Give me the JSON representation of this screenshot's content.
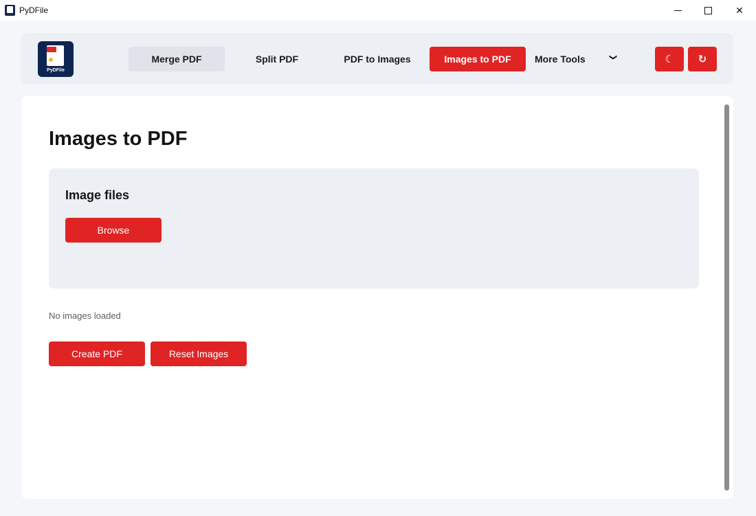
{
  "window": {
    "title": "PyDFile",
    "minimize_glyph": "",
    "maximize_glyph": "",
    "close_glyph": "✕"
  },
  "logo": {
    "badge": "PDF",
    "text": "PyDFile"
  },
  "nav": {
    "merge": "Merge PDF",
    "split": "Split PDF",
    "pdf_to_images": "PDF to Images",
    "images_to_pdf": "Images to PDF",
    "more_tools": "More Tools",
    "more_chevron": "❯",
    "active": "Images to PDF"
  },
  "actions": {
    "theme_icon": "☾",
    "refresh_icon": "↻"
  },
  "main": {
    "title": "Images to PDF",
    "card_title": "Image files",
    "browse_label": "Browse",
    "status": "No images loaded",
    "create_label": "Create PDF",
    "reset_label": "Reset Images"
  },
  "colors": {
    "accent": "#e02424",
    "panel": "#eceff4",
    "background": "#f5f6fa",
    "logo_bg": "#0f2551"
  }
}
